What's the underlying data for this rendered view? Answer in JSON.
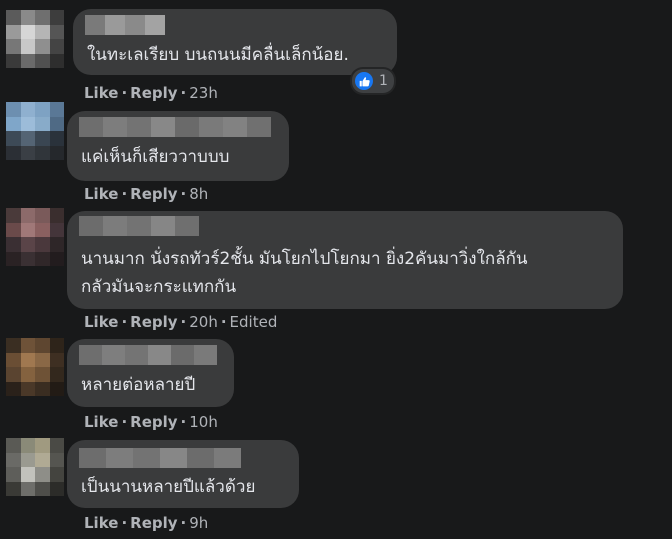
{
  "comments": [
    {
      "text": "ในทะเลเรียบ บนถนนมีคลื่นเล็กน้อย.",
      "like_label": "Like",
      "reply_label": "Reply",
      "time": "23h",
      "edited_label": "",
      "reaction_count": "1"
    },
    {
      "text": "แค่เห็นก็เสียววาบบบ",
      "like_label": "Like",
      "reply_label": "Reply",
      "time": "8h",
      "edited_label": ""
    },
    {
      "text": "นานมาก นั่งรถทัวร์2ชั้น มันโยกไปโยกมา ยิ่ง2คันมาวิ่งใกล้กัน\nกลัวมันจะกระแทกกัน",
      "like_label": "Like",
      "reply_label": "Reply",
      "time": "20h",
      "edited_label": "Edited"
    },
    {
      "text": "หลายต่อหลายปี",
      "like_label": "Like",
      "reply_label": "Reply",
      "time": "10h",
      "edited_label": ""
    },
    {
      "text": "เป็นนานหลายปีแล้วด้วย",
      "like_label": "Like",
      "reply_label": "Reply",
      "time": "9h",
      "edited_label": ""
    }
  ],
  "icons": {
    "reaction": "like-thumbs-up-icon"
  },
  "colors": {
    "background": "#18191a",
    "bubble": "#3a3b3c",
    "text": "#e4e6eb",
    "secondary_text": "#b0b3b8",
    "like_blue": "#1877f2"
  }
}
